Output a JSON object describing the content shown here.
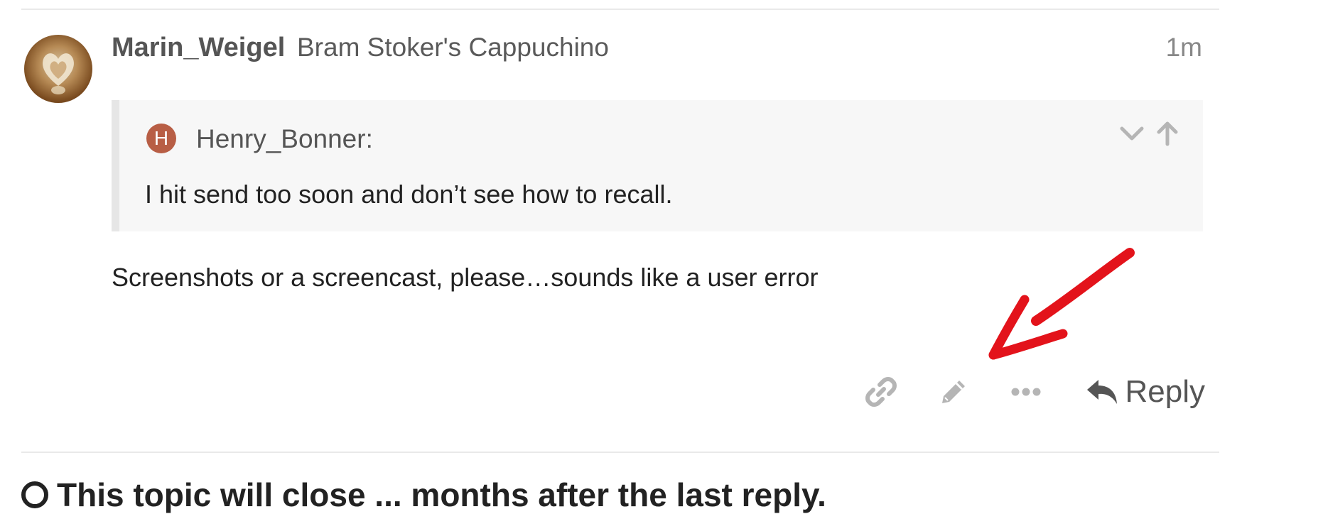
{
  "post": {
    "username": "Marin_Weigel",
    "user_title": "Bram Stoker's Cappuchino",
    "date": "1m",
    "quote": {
      "avatar_letter": "H",
      "author": "Henry_Bonner:",
      "text": "I hit send too soon and don’t see how to recall."
    },
    "body": "Screenshots or a screencast, please…sounds like a user error",
    "actions": {
      "link_icon": "link-icon",
      "edit_icon": "pencil-icon",
      "more_icon": "ellipsis-icon",
      "reply_label": "Reply"
    }
  },
  "next_heading": "This topic will close ... months after the last reply.",
  "colors": {
    "annotation": "#e3131b",
    "quote_avatar": "#b85e45",
    "icon_muted": "#b5b5b5",
    "icon_dark": "#555555"
  }
}
